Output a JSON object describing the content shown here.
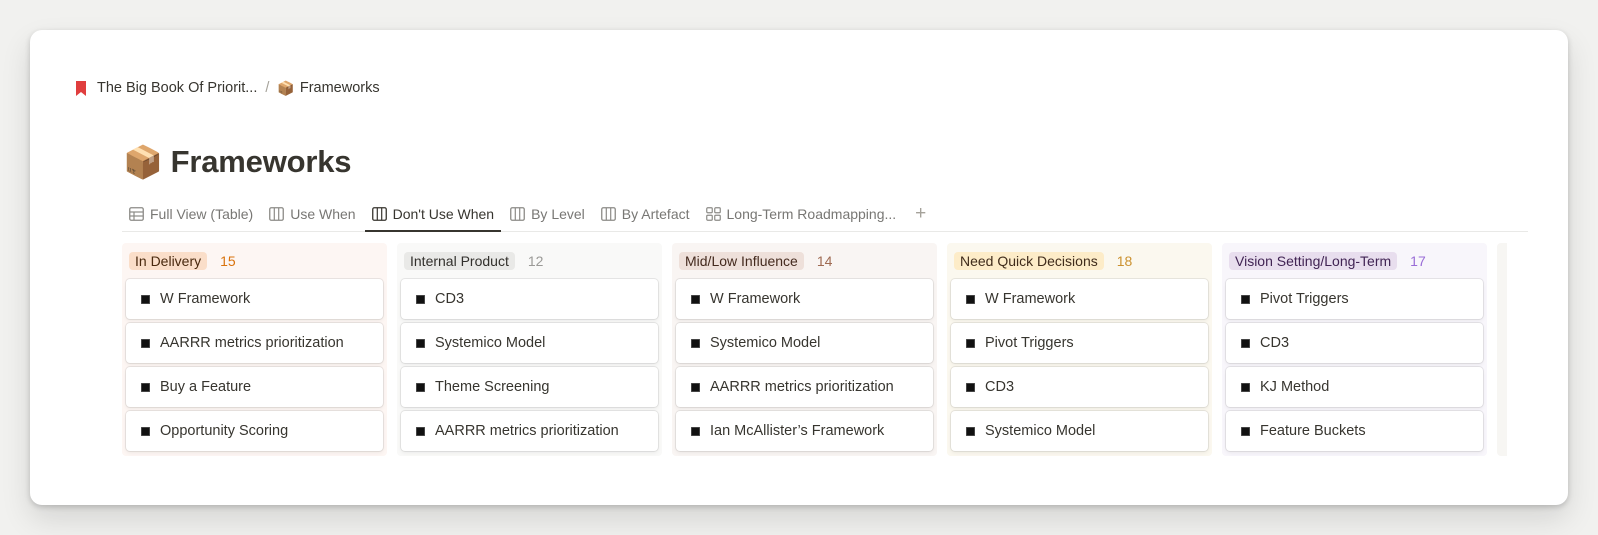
{
  "breadcrumb": {
    "parent": "The Big Book Of Priorit...",
    "separator": "/",
    "current_emoji": "📦",
    "current": "Frameworks"
  },
  "page": {
    "emoji": "📦",
    "title": "Frameworks"
  },
  "tabs": [
    {
      "label": "Full View (Table)",
      "icon": "table-icon"
    },
    {
      "label": "Use When",
      "icon": "board-icon"
    },
    {
      "label": "Don't Use When",
      "icon": "board-icon",
      "active": true
    },
    {
      "label": "By Level",
      "icon": "board-icon"
    },
    {
      "label": "By Artefact",
      "icon": "board-icon"
    },
    {
      "label": "Long-Term Roadmapping...",
      "icon": "gallery-icon"
    }
  ],
  "add_tab": "+",
  "columns": [
    {
      "label": "In Delivery",
      "count": "15",
      "bg": "#fdf6f3",
      "tag_bg": "#fadec9",
      "tag_color": "#49290e",
      "count_color": "#d9730d",
      "cards": [
        "W Framework",
        "AARRR metrics prioritization",
        "Buy a Feature",
        "Opportunity Scoring"
      ]
    },
    {
      "label": "Internal Product",
      "count": "12",
      "bg": "#f9f9f8",
      "tag_bg": "#e9e9e7",
      "tag_color": "#32302c",
      "count_color": "#9b9a97",
      "cards": [
        "CD3",
        "Systemico Model",
        "Theme Screening",
        "AARRR metrics prioritization"
      ]
    },
    {
      "label": "Mid/Low Influence",
      "count": "14",
      "bg": "#f9f5f3",
      "tag_bg": "#eee0da",
      "tag_color": "#442a1e",
      "count_color": "#9f6b53",
      "cards": [
        "W Framework",
        "Systemico Model",
        "AARRR metrics prioritization",
        "Ian McAllister’s Framework"
      ]
    },
    {
      "label": "Need Quick Decisions",
      "count": "18",
      "bg": "#fbf8ef",
      "tag_bg": "#fdecc8",
      "tag_color": "#402c1b",
      "count_color": "#cb912f",
      "cards": [
        "W Framework",
        "Pivot Triggers",
        "CD3",
        "Systemico Model"
      ]
    },
    {
      "label": "Vision Setting/Long-Term",
      "count": "17",
      "bg": "#f8f6fb",
      "tag_bg": "#e8deee",
      "tag_color": "#412454",
      "count_color": "#9a6dd7",
      "cards": [
        "Pivot Triggers",
        "CD3",
        "KJ Method",
        "Feature Buckets"
      ]
    }
  ]
}
